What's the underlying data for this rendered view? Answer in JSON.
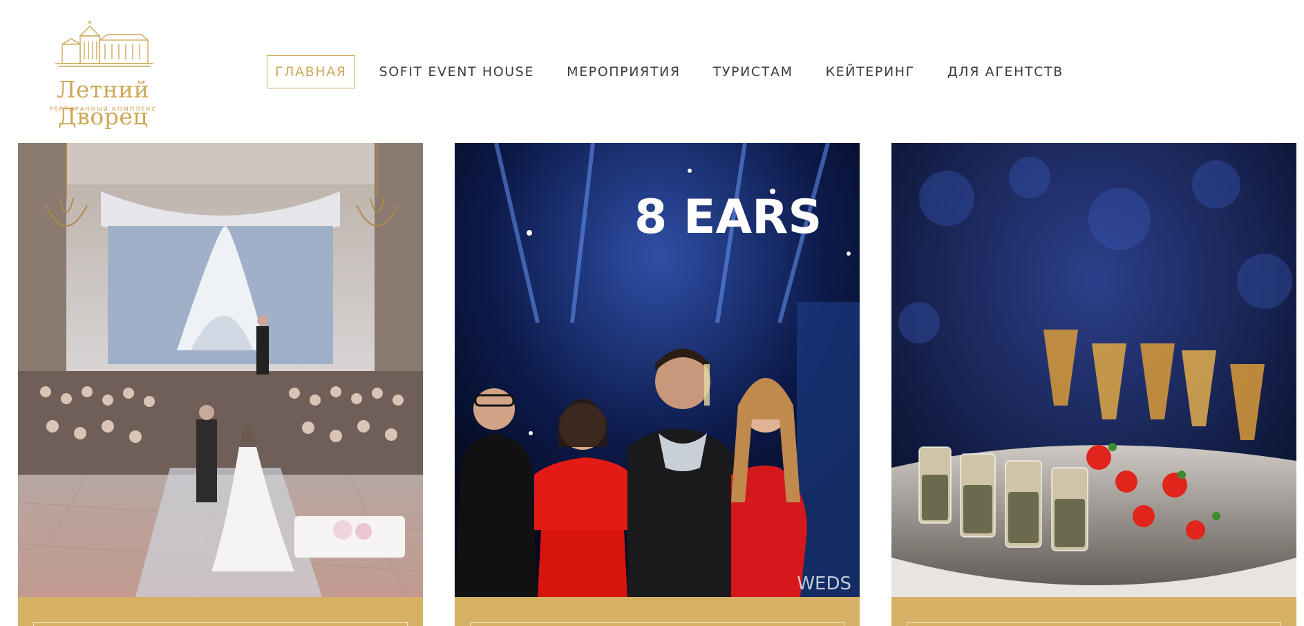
{
  "logo": {
    "title": "Летний Дворец",
    "subtitle": "РЕСТОРАННЫЙ КОМПЛЕКС"
  },
  "nav": {
    "items": [
      {
        "label": "ГЛАВНАЯ",
        "active": true
      },
      {
        "label": "SOFIT EVENT HOUSE",
        "active": false
      },
      {
        "label": "МЕРОПРИЯТИЯ",
        "active": false
      },
      {
        "label": "ТУРИСТАМ",
        "active": false
      },
      {
        "label": "КЕЙТЕРИНГ",
        "active": false
      },
      {
        "label": "ДЛЯ АГЕНТСТВ",
        "active": false
      }
    ]
  },
  "cards": {
    "wedding": {
      "image": "wedding-ceremony-hall-photo"
    },
    "party": {
      "image": "event-guests-photo",
      "bg_text": "8 EARS",
      "watermark": "WEDS"
    },
    "catering": {
      "image": "catering-appetizers-photo"
    }
  },
  "colors": {
    "gold": "#cfa756",
    "band": "#d6b064",
    "nav_text": "#3c3c46"
  }
}
